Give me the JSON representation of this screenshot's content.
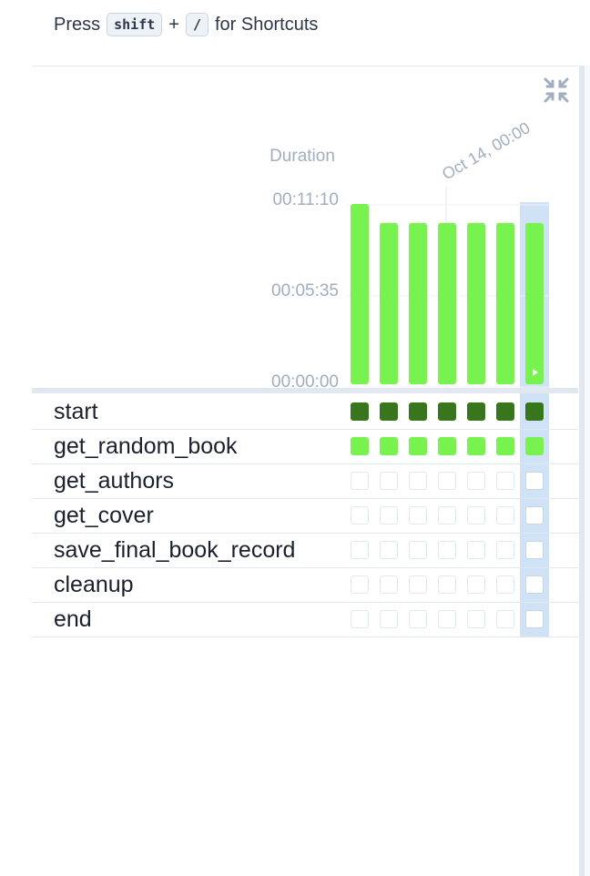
{
  "shortcut_hint": {
    "prefix": "Press",
    "key1": "shift",
    "plus": "+",
    "key2": "/",
    "suffix": "for Shortcuts"
  },
  "chart": {
    "duration_label": "Duration",
    "date_label": "Oct 14, 00:00",
    "y_ticks": [
      "00:11:10",
      "00:05:35",
      "00:00:00"
    ]
  },
  "chart_data": {
    "type": "bar",
    "title": "",
    "ylabel": "Duration",
    "xlabel": "",
    "y_unit": "seconds",
    "ylim": [
      0,
      670
    ],
    "y_tick_labels": [
      "00:00:00",
      "00:05:35",
      "00:11:10"
    ],
    "x_annotation": "Oct 14, 00:00",
    "categories": [
      "1",
      "2",
      "3",
      "4",
      "5",
      "6",
      "7"
    ],
    "values": [
      660,
      590,
      590,
      590,
      590,
      590,
      590
    ],
    "selected_index": 6,
    "color": "#78f24e"
  },
  "colors": {
    "success": "#78f24e",
    "dark_success": "#38761d",
    "selected": "#cfe2f6",
    "grid": "#e2e8f0",
    "muted": "#a0aec0"
  },
  "tasks": [
    {
      "name": "start",
      "states": [
        "dark",
        "dark",
        "dark",
        "dark",
        "dark",
        "dark",
        "dark"
      ]
    },
    {
      "name": "get_random_book",
      "states": [
        "light",
        "light",
        "light",
        "light",
        "light",
        "light",
        "light"
      ]
    },
    {
      "name": "get_authors",
      "states": [
        "empty",
        "empty",
        "empty",
        "empty",
        "empty",
        "empty",
        "empty"
      ]
    },
    {
      "name": "get_cover",
      "states": [
        "empty",
        "empty",
        "empty",
        "empty",
        "empty",
        "empty",
        "empty"
      ]
    },
    {
      "name": "save_final_book_record",
      "states": [
        "empty",
        "empty",
        "empty",
        "empty",
        "empty",
        "empty",
        "empty"
      ]
    },
    {
      "name": "cleanup",
      "states": [
        "empty",
        "empty",
        "empty",
        "empty",
        "empty",
        "empty",
        "empty"
      ]
    },
    {
      "name": "end",
      "states": [
        "empty",
        "empty",
        "empty",
        "empty",
        "empty",
        "empty",
        "empty"
      ]
    }
  ],
  "icons": {
    "collapse": "collapse-arrows-icon",
    "play": "play-icon"
  }
}
